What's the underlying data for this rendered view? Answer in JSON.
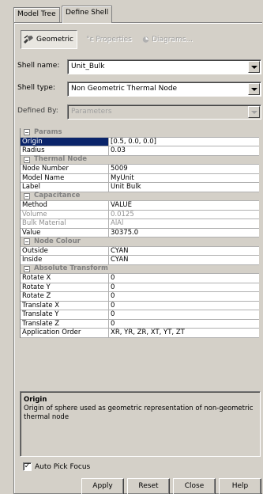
{
  "tabs": [
    {
      "label": "Model Tree"
    },
    {
      "label": "Define Shell"
    }
  ],
  "toolbar": {
    "geometric_label": "Geometric",
    "properties_label": "Properties",
    "diagrams_label": "Diagrams..."
  },
  "form": {
    "shell_name_label": "Shell name:",
    "shell_name_value": "Unit_Bulk",
    "shell_type_label": "Shell type:",
    "shell_type_value": "Non Geometric Thermal Node",
    "defined_by_label": "Defined By:",
    "defined_by_value": "Parameters"
  },
  "groups": {
    "params": "Params",
    "thermal_node": "Thermal Node",
    "capacitance": "Capacitance",
    "node_colour": "Node Colour",
    "absolute_transform": "Absolute Transform"
  },
  "rows": {
    "origin": {
      "name": "Origin",
      "value": "[0.5, 0.0, 0.0]"
    },
    "radius": {
      "name": "Radius",
      "value": "0.03"
    },
    "node_number": {
      "name": "Node Number",
      "value": "5009"
    },
    "model_name": {
      "name": "Model Name",
      "value": "MyUnit"
    },
    "label": {
      "name": "Label",
      "value": "Unit Bulk"
    },
    "method": {
      "name": "Method",
      "value": "VALUE"
    },
    "volume": {
      "name": "Volume",
      "value": "0.0125"
    },
    "bulk_material": {
      "name": "Bulk Material",
      "value": "AlAl"
    },
    "value": {
      "name": "Value",
      "value": "30375.0"
    },
    "outside": {
      "name": "Outside",
      "value": "CYAN"
    },
    "inside": {
      "name": "Inside",
      "value": "CYAN"
    },
    "rotate_x": {
      "name": "Rotate X",
      "value": "0"
    },
    "rotate_y": {
      "name": "Rotate Y",
      "value": "0"
    },
    "rotate_z": {
      "name": "Rotate Z",
      "value": "0"
    },
    "translate_x": {
      "name": "Translate X",
      "value": "0"
    },
    "translate_y": {
      "name": "Translate Y",
      "value": "0"
    },
    "translate_z": {
      "name": "Translate Z",
      "value": "0"
    },
    "application_order": {
      "name": "Application Order",
      "value": "XR, YR, ZR, XT, YT, ZT"
    }
  },
  "description": {
    "title": "Origin",
    "text": "Origin of sphere used as geometric representation of non-geometric thermal node"
  },
  "auto_pick": {
    "label": "Auto Pick Focus",
    "checked": true
  },
  "buttons": {
    "apply": "Apply",
    "reset": "Reset",
    "close": "Close",
    "help": "Help"
  },
  "colors": {
    "selection": "#0a246a",
    "panel": "#d4d0c8"
  },
  "icons": [
    "geometric-icon",
    "properties-icon",
    "diagrams-icon",
    "dropdown-arrow-icon",
    "collapse-icon",
    "check-icon"
  ]
}
